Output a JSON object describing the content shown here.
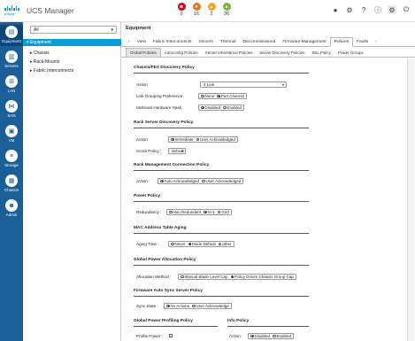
{
  "app": {
    "brand": "cisco",
    "title": "UCS Manager"
  },
  "faults": [
    {
      "count": "0",
      "color": "#d0021b",
      "glyph": "⊗",
      "icon": "critical-fault-icon"
    },
    {
      "count": "16",
      "color": "#e87722",
      "glyph": "▼",
      "icon": "major-fault-icon"
    },
    {
      "count": "2",
      "color": "#f5a623",
      "glyph": "▲",
      "icon": "minor-fault-icon"
    },
    {
      "count": "36",
      "color": "#7cb342",
      "glyph": "▲",
      "icon": "warning-fault-icon"
    }
  ],
  "topicons": [
    "●",
    "⚙",
    "?",
    "ⓘ",
    "⚙",
    "⏻"
  ],
  "rail": [
    {
      "label": "Equipment",
      "glyph": "▤",
      "icon": "equipment-icon"
    },
    {
      "label": "Servers",
      "glyph": "▥",
      "icon": "servers-icon"
    },
    {
      "label": "LAN",
      "glyph": "⊞",
      "icon": "lan-icon"
    },
    {
      "label": "SAN",
      "glyph": "⋈",
      "icon": "san-icon"
    },
    {
      "label": "VM",
      "glyph": "▣",
      "icon": "vm-icon"
    },
    {
      "label": "Storage",
      "glyph": "≡",
      "icon": "storage-icon"
    },
    {
      "label": "Chassis",
      "glyph": "▦",
      "icon": "chassis-icon"
    },
    {
      "label": "Admin",
      "glyph": "☻",
      "icon": "admin-icon"
    }
  ],
  "nav": {
    "filter": "All",
    "root": "▾ Equipment",
    "items": [
      "▸ Chassis",
      "▸ Rack-Mounts",
      "▸ Fabric Interconnects"
    ]
  },
  "main": {
    "title": "Equipment",
    "tabs": [
      "‹",
      "View",
      "Fabric Interconnects",
      "Servers",
      "Thermal",
      "Decommissioned",
      "Firmware Management",
      "Policies",
      "Faults",
      "›"
    ],
    "active_tab": "Policies",
    "subtabs": [
      "Global Policies",
      "Autoconfig Policies",
      "Server Inheritance Policies",
      "Server Discovery Policies",
      "SEL Policy",
      "Power Groups"
    ],
    "active_subtab": "Global Policies"
  },
  "sections": {
    "chassis": {
      "title": "Chassis/FEX Discovery Policy",
      "action_label": "Action",
      "action_value": "4 Link",
      "link_label": "Link Grouping Preference",
      "link_opts": [
        "None",
        "Port Channel"
      ],
      "link_sel": 1,
      "hash_label": "Multicast Hardware Hash",
      "hash_opts": [
        "Disabled",
        "Enabled"
      ],
      "hash_sel": 0
    },
    "rack": {
      "title": "Rack Server Discovery Policy",
      "action_label": "Action",
      "action_opts": [
        "Immediate",
        "User Acknowledged"
      ],
      "action_sel": 0,
      "scrub_label": "Scrub Policy :",
      "scrub_value": "default"
    },
    "rackmgmt": {
      "title": "Rack Management Connection Policy",
      "action_label": "Action :",
      "opts": [
        "Auto Acknowledged",
        "User Acknowledged"
      ],
      "sel": 0
    },
    "power": {
      "title": "Power Policy",
      "label": "Redundancy :",
      "opts": [
        "Non Redundant",
        "N+1",
        "Grid"
      ],
      "sel": 1
    },
    "mac": {
      "title": "MAC Address Table Aging",
      "label": "Aging Time :",
      "opts": [
        "Never",
        "Mode Default",
        "other"
      ],
      "sel": 1
    },
    "gpa": {
      "title": "Global Power Allocation Policy",
      "label": "Allocation Method :",
      "opts": [
        "Manual Blade Level Cap",
        "Policy Driven Chassis Group Cap"
      ],
      "sel": 1
    },
    "fw": {
      "title": "Firmware Auto Sync Server Policy",
      "label": "Sync State :",
      "opts": [
        "No Actions",
        "User Acknowledge"
      ],
      "sel": 0
    },
    "gpp": {
      "title": "Global Power Profiling Policy",
      "label": "Profile Power :"
    },
    "info": {
      "title": "Info Policy",
      "label": "Action :",
      "opts": [
        "Disabled",
        "Enabled"
      ],
      "sel": 0
    }
  }
}
